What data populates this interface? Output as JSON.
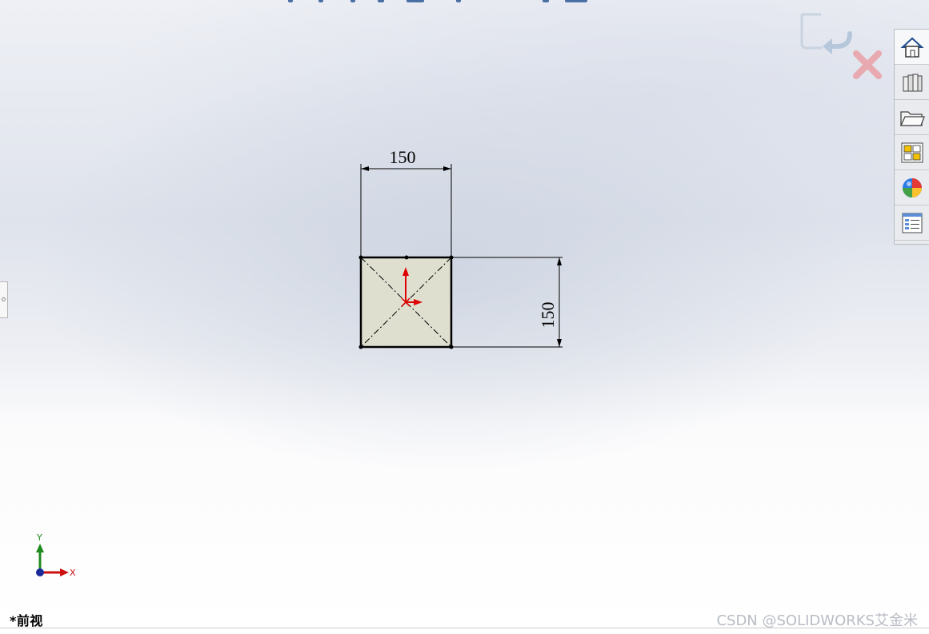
{
  "view": {
    "name": "*前视",
    "watermark": "CSDN @SOLIDWORKS艾金米"
  },
  "sketch": {
    "shape": "square",
    "fill_color": "#dedfcf",
    "dimensions": [
      {
        "id": "horizontal-dimension",
        "value": "150",
        "orientation": "horizontal"
      },
      {
        "id": "vertical-dimension",
        "value": "150",
        "orientation": "vertical"
      }
    ]
  },
  "triad": {
    "x_label": "X",
    "y_label": "Y"
  },
  "task_pane": {
    "items": [
      {
        "icon": "home-icon"
      },
      {
        "icon": "library-icon"
      },
      {
        "icon": "folder-icon"
      },
      {
        "icon": "view-palette-icon"
      },
      {
        "icon": "appearance-icon"
      },
      {
        "icon": "properties-icon"
      }
    ]
  },
  "confirmation_corner": {
    "items": [
      {
        "icon": "exit-sketch-icon"
      },
      {
        "icon": "cancel-icon"
      }
    ]
  },
  "colors": {
    "origin_red": "#e00000",
    "x_axis_red": "#cc1010",
    "y_axis_green": "#1f8a1f",
    "cancel_red": "#e8aab0",
    "confirm_blue": "#b6c7dc"
  }
}
